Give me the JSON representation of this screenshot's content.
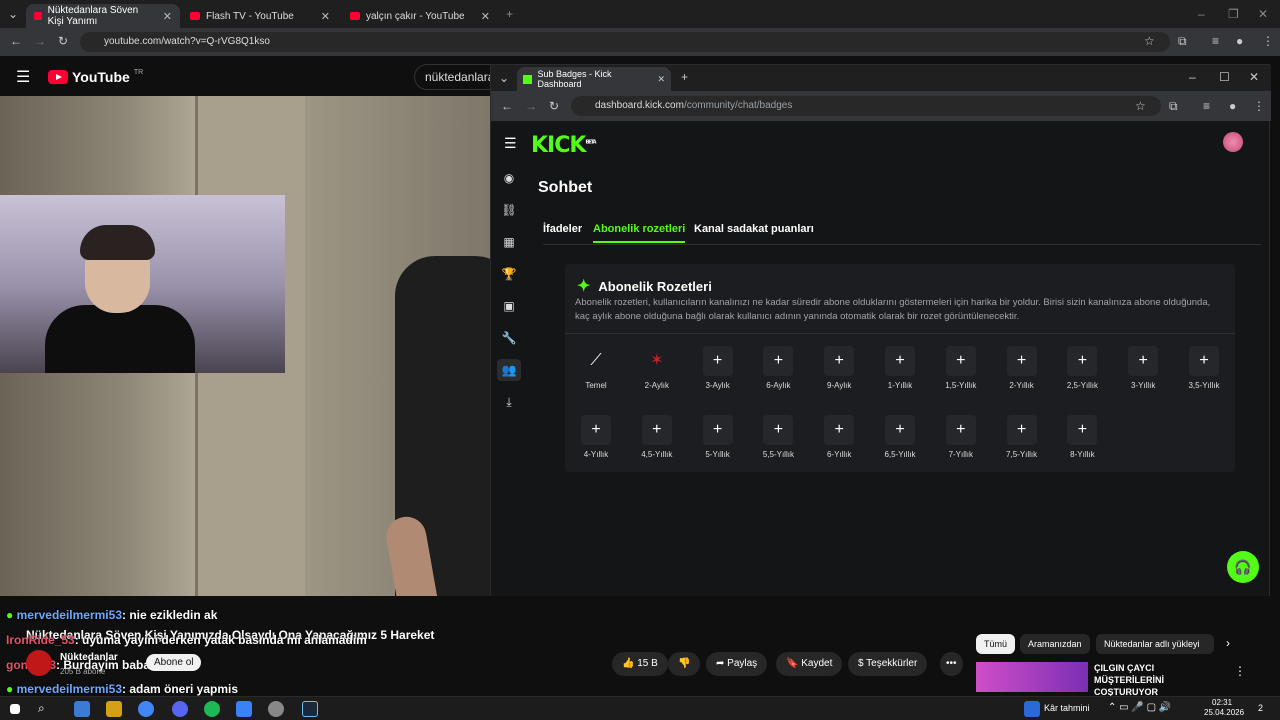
{
  "outer_browser": {
    "tabs": [
      {
        "label": "Nüktedanlara Söven Kişi Yanımı"
      },
      {
        "label": "Flash TV - YouTube"
      },
      {
        "label": "yalçın çakır - YouTube"
      }
    ],
    "address": "youtube.com/watch?v=Q-rVG8Q1kso"
  },
  "youtube": {
    "logo_text": "YouTube",
    "region": "TR",
    "search_text": "nüktedanlara i",
    "video_title": "Nüktedanlara Söven Kişi Yanımızda Olsaydı Ona Yapacağımız 5 Hareket",
    "channel_name": "Nüktedanlar",
    "subscribers": "205 B abone",
    "subscribe_label": "Abone ol",
    "like_count": "15 B",
    "share_label": "Paylaş",
    "save_label": "Kaydet",
    "thanks_label": "Teşekkürler",
    "more_label": "•••",
    "chips": [
      {
        "label": "Tümü"
      },
      {
        "label": "Aramanızdan"
      },
      {
        "label": "Nüktedanlar adlı yükleyi"
      }
    ],
    "recommendation_title": "ÇILGIN ÇAYCI MÜŞTERİLERİNİ COŞTURUYOR"
  },
  "chat_overlay": [
    {
      "user": "mervedeilmermi53",
      "message": ": nie ezikledin ak"
    },
    {
      "user": "IronRide_53",
      "message": ": uyuma yayini derken yatak basında mi anlamadim"
    },
    {
      "user": "gonarl53",
      "message": ": Burdayim babacim"
    },
    {
      "user": "mervedeilmermi53",
      "message": ": adam öneri yapmis"
    }
  ],
  "inner_browser": {
    "tab_title": "Sub Badges - Kick Dashboard",
    "address_host": "dashboard.kick.com",
    "address_path": "/community/chat/badges"
  },
  "kick": {
    "logo": "KICK",
    "logo_sup": "BETA",
    "page_title": "Sohbet",
    "tabs": [
      {
        "label": "İfadeler"
      },
      {
        "label": "Abonelik rozetleri"
      },
      {
        "label": "Kanal sadakat puanları"
      }
    ],
    "card_title": "Abonelik Rozetleri",
    "card_desc": "Abonelik rozetleri, kullanıcıların kanalınızı ne kadar süredir abone olduklarını göstermeleri için harika bir yoldur. Birisi sizin kanalınıza abone olduğunda, kaç aylık abone olduğuna bağlı olarak kullanıcı adının yanında otomatik olarak bir rozet görüntülenecektir.",
    "badges_row1": [
      {
        "label": "Temel",
        "icon": "sperm-badge"
      },
      {
        "label": "2-Aylık",
        "icon": "red-figure-badge"
      },
      {
        "label": "3-Aylık",
        "icon": "+"
      },
      {
        "label": "6-Aylık",
        "icon": "+"
      },
      {
        "label": "9-Aylık",
        "icon": "+"
      },
      {
        "label": "1-Yıllık",
        "icon": "+"
      },
      {
        "label": "1,5-Yıllık",
        "icon": "+"
      },
      {
        "label": "2-Yıllık",
        "icon": "+"
      },
      {
        "label": "2,5-Yıllık",
        "icon": "+"
      },
      {
        "label": "3-Yıllık",
        "icon": "+"
      },
      {
        "label": "3,5-Yıllık",
        "icon": "+"
      }
    ],
    "badges_row2": [
      {
        "label": "4-Yıllık",
        "icon": "+"
      },
      {
        "label": "4,5-Yıllık",
        "icon": "+"
      },
      {
        "label": "5-Yıllık",
        "icon": "+"
      },
      {
        "label": "5,5-Yıllık",
        "icon": "+"
      },
      {
        "label": "6-Yıllık",
        "icon": "+"
      },
      {
        "label": "6,5-Yıllık",
        "icon": "+"
      },
      {
        "label": "7-Yıllık",
        "icon": "+"
      },
      {
        "label": "7,5-Yıllık",
        "icon": "+"
      },
      {
        "label": "8-Yıllık",
        "icon": "+"
      }
    ],
    "accent_color": "#53fc18"
  },
  "taskbar": {
    "weather": "Kâr tahmini",
    "time": "02:31",
    "date": "25.04.2026",
    "notifications": "2"
  }
}
